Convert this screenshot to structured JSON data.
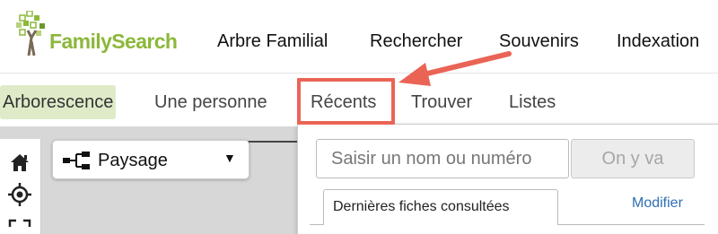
{
  "header": {
    "logo_text": "FamilySearch",
    "nav": [
      "Arbre Familial",
      "Rechercher",
      "Souvenirs",
      "Indexation"
    ]
  },
  "subnav": {
    "tabs": [
      "Arborescence",
      "Une personne",
      "Récents",
      "Trouver",
      "Listes"
    ],
    "active_tab": "Arborescence",
    "highlighted_tab": "Récents"
  },
  "view_selector": {
    "label": "Paysage",
    "caret": "▼"
  },
  "recents": {
    "search_placeholder": "Saisir un nom ou numéro",
    "go_label": "On y va",
    "tab_label": "Dernières fiches consultées",
    "modify_label": "Modifier"
  },
  "colors": {
    "brand_green": "#8cb83a",
    "active_tab_bg": "#dfebc8",
    "annotation_red": "#ea6456",
    "link_blue": "#2f6fb3"
  }
}
